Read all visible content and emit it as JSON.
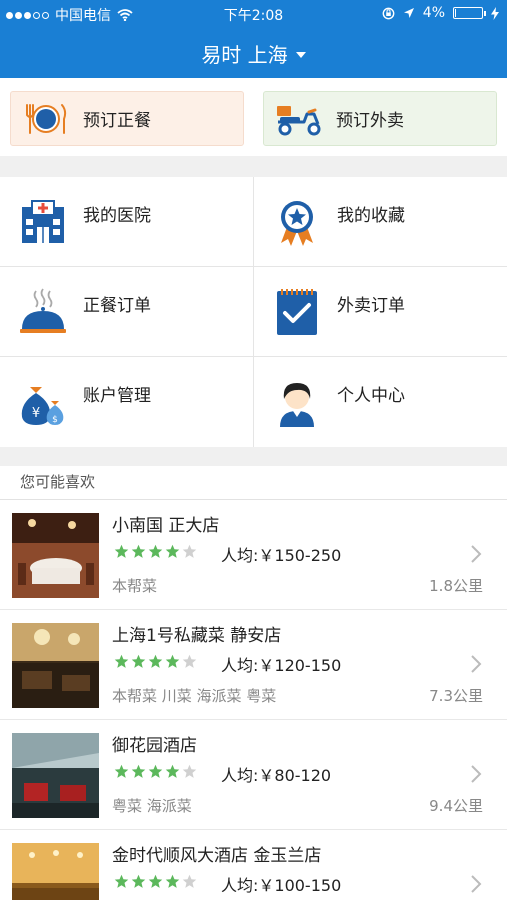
{
  "status_bar": {
    "carrier": "中国电信",
    "time": "下午2:08",
    "battery_percent": "4%",
    "battery_level": 0.04,
    "signal_bars": 3,
    "signal_total": 5,
    "icons": [
      "wifi-icon",
      "rotation-lock-icon",
      "location-arrow-icon",
      "battery-icon",
      "charging-bolt-icon"
    ]
  },
  "nav": {
    "title": "易时 上海",
    "dropdown_icon": "caret-down-icon"
  },
  "order_buttons": {
    "dine_in_label": "预订正餐",
    "takeout_label": "预订外卖"
  },
  "grid": {
    "items": [
      {
        "label": "我的医院",
        "icon": "hospital-icon"
      },
      {
        "label": "我的收藏",
        "icon": "favorite-medal-icon"
      },
      {
        "label": "正餐订单",
        "icon": "food-cloche-icon"
      },
      {
        "label": "外卖订单",
        "icon": "checklist-icon"
      },
      {
        "label": "账户管理",
        "icon": "money-bag-icon"
      },
      {
        "label": "个人中心",
        "icon": "user-avatar-icon"
      }
    ]
  },
  "recommendations": {
    "header": "您可能喜欢",
    "items": [
      {
        "name": "小南国 正大店",
        "rating": 4,
        "rating_max": 5,
        "price": "人均:￥150-250",
        "cuisine": "本帮菜",
        "distance": "1.8公里"
      },
      {
        "name": "上海1号私藏菜 静安店",
        "rating": 4,
        "rating_max": 5,
        "price": "人均:￥120-150",
        "cuisine": "本帮菜 川菜 海派菜 粤菜",
        "distance": "7.3公里"
      },
      {
        "name": "御花园酒店",
        "rating": 4,
        "rating_max": 5,
        "price": "人均:￥80-120",
        "cuisine": "粤菜 海派菜",
        "distance": "9.4公里"
      },
      {
        "name": "金时代顺风大酒店 金玉兰店",
        "rating": 4,
        "rating_max": 5,
        "price": "人均:￥100-150",
        "cuisine": "",
        "distance": ""
      }
    ]
  },
  "colors": {
    "primary": "#1a7fd4",
    "star_on": "#5cb85c",
    "star_off": "#d0d0d0",
    "dine_bg": "#fdf0e7",
    "takeout_bg": "#eef5ea"
  }
}
